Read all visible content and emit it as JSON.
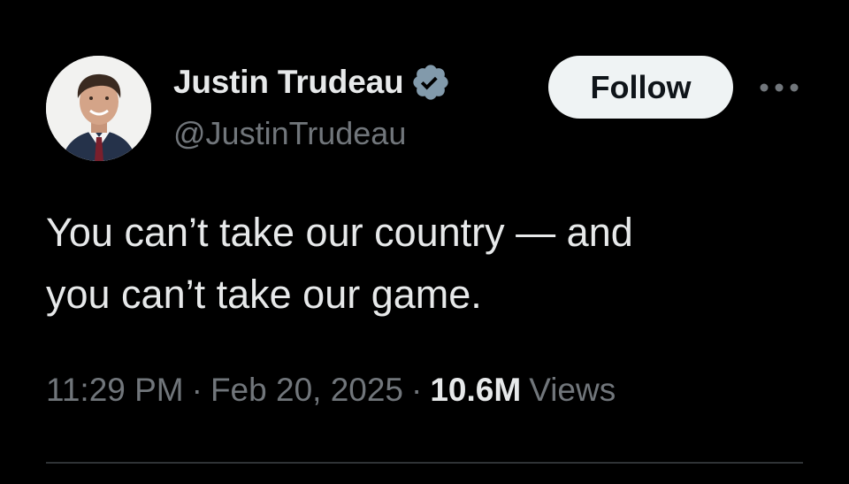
{
  "author": {
    "display_name": "Justin Trudeau",
    "handle": "@JustinTrudeau",
    "verified_icon": "verified-badge-icon",
    "verified_color": "#829aab",
    "avatar_icon": "profile-photo"
  },
  "actions": {
    "follow_label": "Follow",
    "more_icon": "more-dots-icon"
  },
  "tweet": {
    "lines": [
      "You can’t take our country — and",
      "you can’t take our game."
    ]
  },
  "meta": {
    "time": "11:29 PM",
    "separator": "·",
    "date": "Feb 20, 2025",
    "views_count": "10.6M",
    "views_label": "Views"
  },
  "colors": {
    "background": "#000000",
    "primary_text": "#e7e9ea",
    "secondary_text": "#71767b",
    "follow_bg": "#eff3f4",
    "divider": "#2f3336"
  }
}
